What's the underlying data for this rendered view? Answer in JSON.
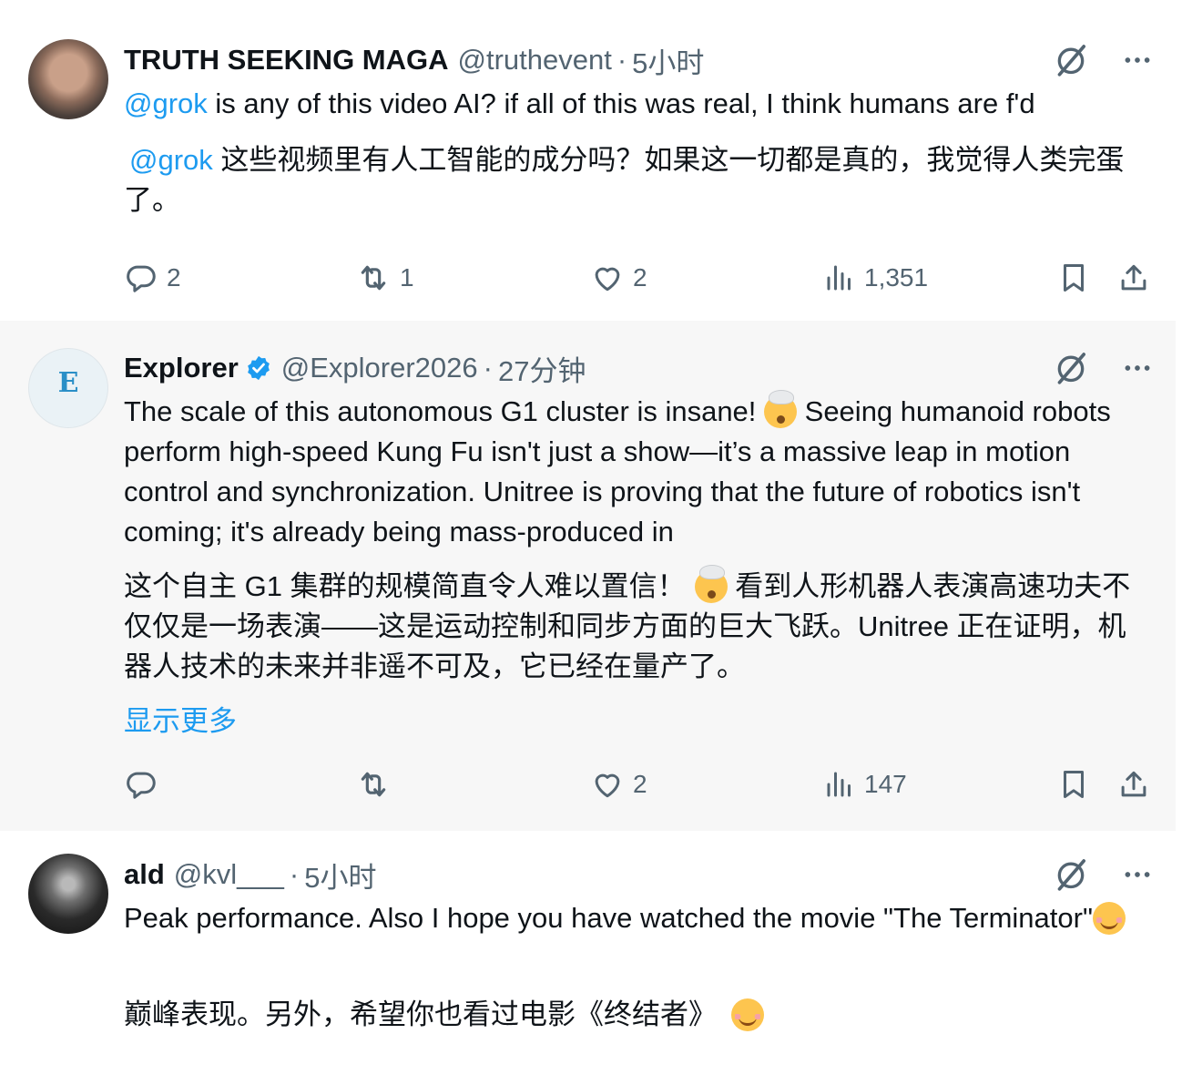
{
  "posts": [
    {
      "name": "TRUTH SEEKING MAGA",
      "handle": "@truthevent",
      "separator": "·",
      "time": "5小时",
      "verified": false,
      "text_mention": "@grok",
      "text_en": " is any of this video AI? if all of this was real, I think humans are f'd",
      "translation_mention": "@grok",
      "translation": " 这些视频里有人工智能的成分吗？如果这一切都是真的，我觉得人类完蛋了。",
      "replies": "2",
      "reposts": "1",
      "likes": "2",
      "views": "1,351"
    },
    {
      "name": "Explorer",
      "handle": "@Explorer2026",
      "separator": "·",
      "time": "27分钟",
      "verified": true,
      "avatar_text": "E",
      "text_en_before_emoji": "The scale of this autonomous G1 cluster is insane! ",
      "text_en_after_emoji": " Seeing humanoid robots perform high-speed Kung Fu isn't just a show—it’s a massive leap in motion control and synchronization. Unitree is proving that the future of robotics isn't coming; it's already being mass-produced in",
      "translation_before_emoji": "这个自主 G1 集群的规模简直令人难以置信！",
      "translation_after_emoji": " 看到人形机器人表演高速功夫不仅仅是一场表演——这是运动控制和同步方面的巨大飞跃。Unitree 正在证明，机器人技术的未来并非遥不可及，它已经在量产了。",
      "show_more": "显示更多",
      "replies": "",
      "reposts": "",
      "likes": "2",
      "views": "147"
    },
    {
      "name": "ald",
      "handle": "@kvl___",
      "separator": "·",
      "time": "5小时",
      "verified": false,
      "text_en": "Peak performance. Also I hope you have watched the movie \"The Terminator\"",
      "translation": "巅峰表现。另外，希望你也看过电影《终结者》"
    }
  ],
  "icons": {
    "grok": "grok-slash-icon",
    "more": "more-dots-icon",
    "reply": "reply-bubble-icon",
    "repost": "repost-arrows-icon",
    "like": "heart-icon",
    "views": "views-bars-icon",
    "bookmark": "bookmark-icon",
    "share": "share-icon",
    "verified": "verified-badge-icon",
    "emoji_blow": "exploding-head-emoji",
    "emoji_smile": "smiling-face-emoji"
  },
  "colors": {
    "accent": "#1d9bf0",
    "muted": "#536471",
    "text": "#0f1419",
    "highlight_bg": "#f7f7f7"
  }
}
